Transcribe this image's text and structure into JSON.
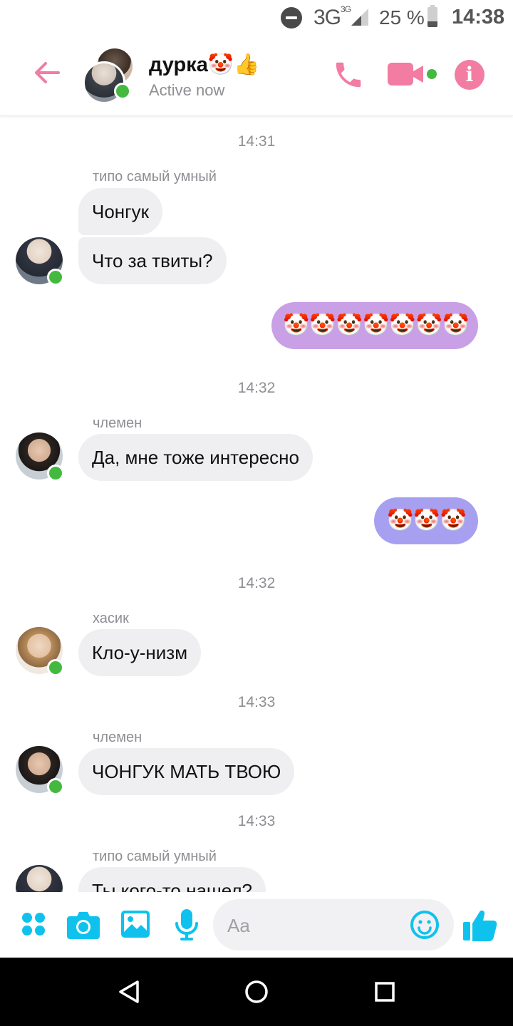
{
  "status_bar": {
    "network": "3G",
    "network_sup": "3G",
    "battery": "25 %",
    "time": "14:38"
  },
  "header": {
    "title": "дурка🤡👍",
    "status": "Active now"
  },
  "messages": {
    "ts1": "14:31",
    "s1": "типо самый умный",
    "m1": "Чонгук",
    "m2": "Что за твиты?",
    "o1": "🤡🤡🤡🤡🤡🤡🤡",
    "ts2": "14:32",
    "s2": "члемен",
    "m3": "Да, мне тоже интересно",
    "o2": "🤡🤡🤡",
    "ts3": "14:32",
    "s3": "хасик",
    "m4": "Кло-у-низм",
    "ts4": "14:33",
    "s4": "члемен",
    "m5": "ЧОНГУК МАТЬ ТВОЮ",
    "ts5": "14:33",
    "s5": "типо самый умный",
    "m6": "Ты кого-то нашел?"
  },
  "composer": {
    "placeholder": "Aa"
  },
  "icons": {
    "status": [
      "dnd-icon",
      "signal-icon",
      "battery-icon"
    ],
    "header": [
      "back-arrow-icon",
      "phone-icon",
      "video-camera-icon",
      "info-icon"
    ],
    "composer": [
      "more-dots-icon",
      "camera-icon",
      "image-icon",
      "microphone-icon",
      "emoji-icon",
      "thumbs-up-icon"
    ],
    "nav": [
      "nav-back-icon",
      "nav-home-icon",
      "nav-recents-icon"
    ]
  },
  "colors": {
    "accent_pink": "#f27ca2",
    "accent_blue": "#0fc2ee",
    "online": "#44b940",
    "outgoing_1": "#c9a0e6",
    "outgoing_2": "#a7a0f1",
    "incoming": "#efeff1"
  }
}
